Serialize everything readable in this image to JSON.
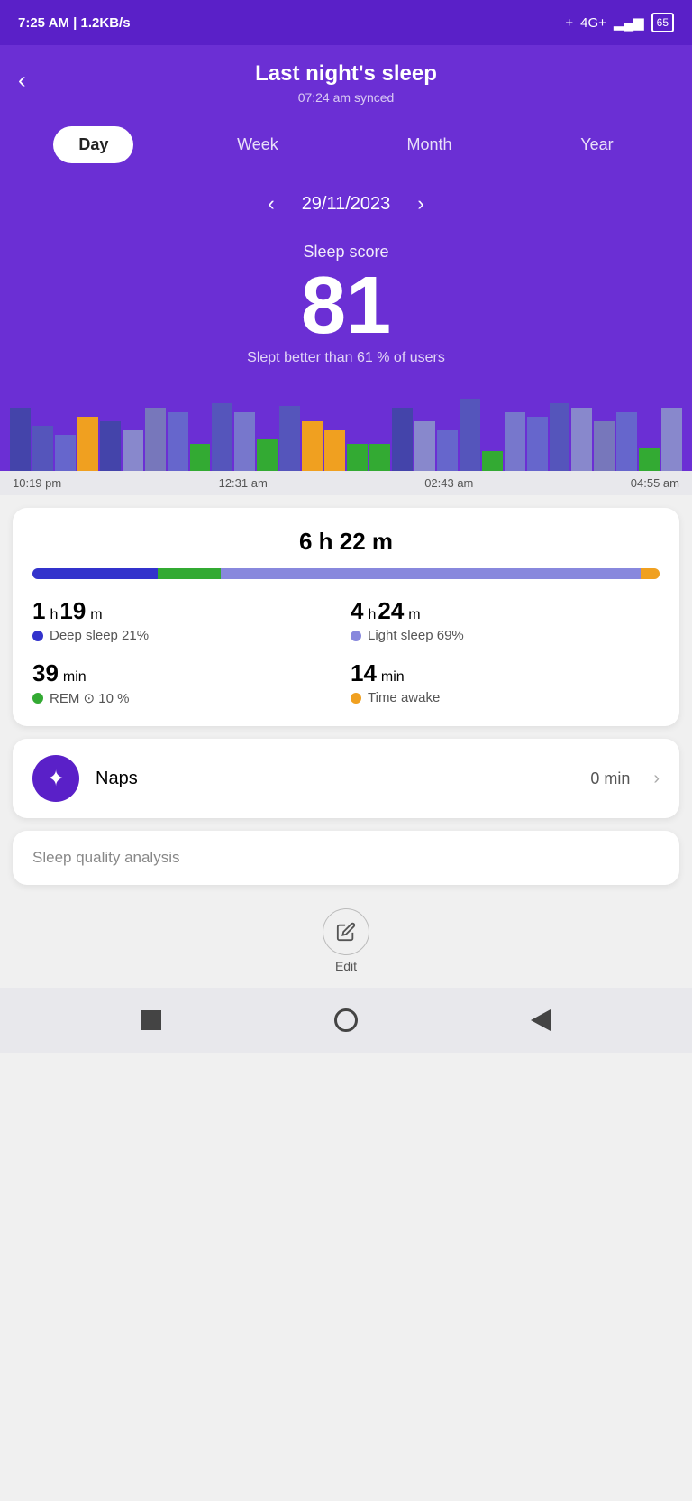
{
  "statusBar": {
    "time": "7:25 AM",
    "network": "1.2KB/s",
    "battery": "65"
  },
  "header": {
    "title": "Last night's sleep",
    "syncTime": "07:24 am synced",
    "backLabel": "‹"
  },
  "tabs": [
    {
      "label": "Day",
      "active": true
    },
    {
      "label": "Week",
      "active": false
    },
    {
      "label": "Month",
      "active": false
    },
    {
      "label": "Year",
      "active": false
    }
  ],
  "dateNav": {
    "date": "29/11/2023",
    "prevArrow": "‹",
    "nextArrow": "›"
  },
  "sleepScore": {
    "label": "Sleep score",
    "value": "81",
    "description": "Slept better than 61 % of users"
  },
  "chartTimeLabels": [
    "10:19 pm",
    "12:31 am",
    "02:43 am",
    "04:55 am"
  ],
  "sleepDuration": {
    "total": "6 h 22 m",
    "stats": [
      {
        "value": "1",
        "unit1": "h",
        "value2": "19",
        "unit2": "m",
        "label": "Deep sleep 21%",
        "dotColor": "#3333cc"
      },
      {
        "value": "4",
        "unit1": "h",
        "value2": "24",
        "unit2": "m",
        "label": "Light sleep 69%",
        "dotColor": "#8888dd"
      },
      {
        "value": "39",
        "unit1": "",
        "value2": "",
        "unit2": "min",
        "label": "REM ⊙ 10 %",
        "dotColor": "#33aa33"
      },
      {
        "value": "14",
        "unit1": "",
        "value2": "",
        "unit2": "min",
        "label": "Time awake",
        "dotColor": "#f0a020"
      }
    ]
  },
  "naps": {
    "label": "Naps",
    "value": "0 min",
    "icon": "✦"
  },
  "sleepQuality": {
    "label": "Sleep quality analysis"
  },
  "editBar": {
    "label": "Edit",
    "icon": "✎"
  },
  "progressBar": {
    "segments": [
      {
        "color": "#3333cc",
        "pct": 20
      },
      {
        "color": "#33aa33",
        "pct": 10
      },
      {
        "color": "#8888dd",
        "pct": 67
      },
      {
        "color": "#f0a020",
        "pct": 3
      }
    ]
  }
}
